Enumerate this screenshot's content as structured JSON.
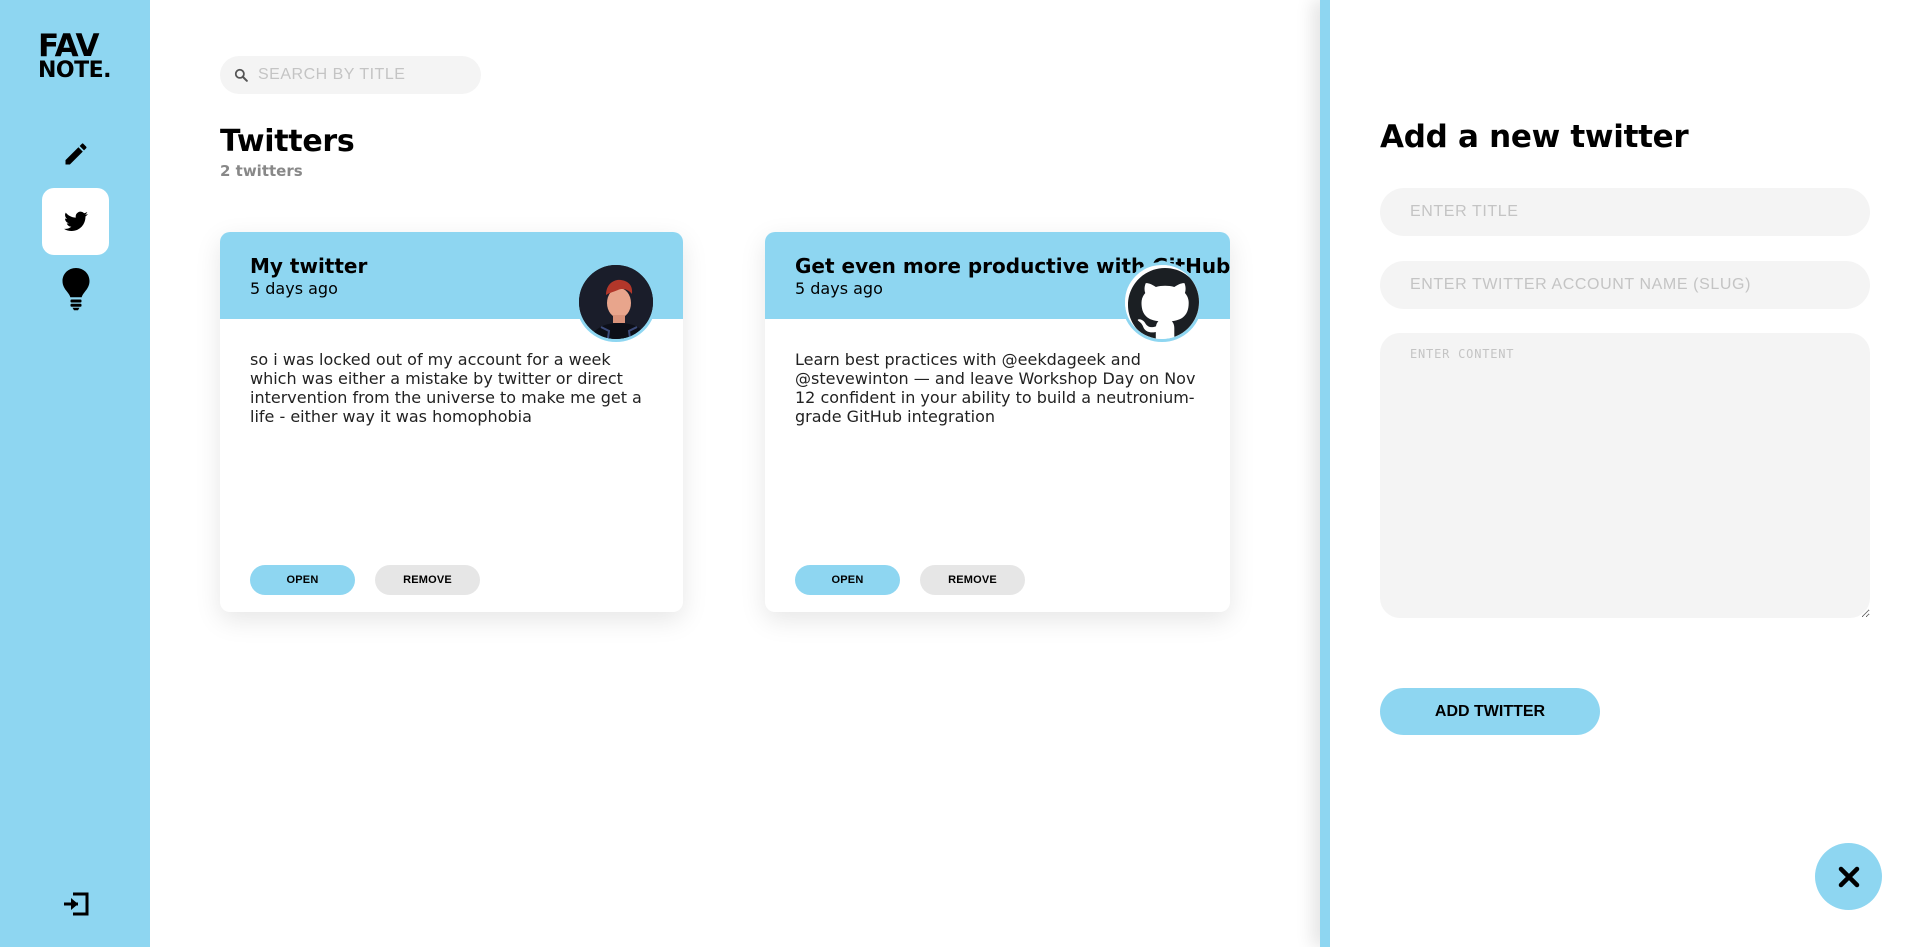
{
  "sidebar": {
    "logo_line1": "FAV",
    "logo_line2": "NOTE.",
    "items": [
      {
        "icon": "pen-icon",
        "active": false
      },
      {
        "icon": "twitter-icon",
        "active": true
      },
      {
        "icon": "bulb-icon",
        "active": false
      }
    ],
    "logout_icon": "logout-icon"
  },
  "main": {
    "search": {
      "placeholder": "SEARCH BY TITLE",
      "value": ""
    },
    "title": "Twitters",
    "count": "2 twitters",
    "cards": [
      {
        "title": "My twitter",
        "date": "5 days ago",
        "content": "so i was locked out of my account for a week which was either a mistake by twitter or direct intervention from the universe to make me get a life - either way it was homophobia",
        "open_label": "OPEN",
        "remove_label": "REMOVE"
      },
      {
        "title": "Get even more productive with GitHub",
        "date": "5 days ago",
        "content": "Learn best practices with @eekdageek and @stevewinton — and leave Workshop Day on Nov 12 confident in your ability to build a neutronium-grade GitHub integration",
        "open_label": "OPEN",
        "remove_label": "REMOVE"
      }
    ]
  },
  "panel": {
    "title": "Add a new twitter",
    "title_placeholder": "ENTER TITLE",
    "slug_placeholder": "ENTER TWITTER ACCOUNT NAME (SLUG)",
    "content_placeholder": "ENTER CONTENT",
    "add_label": "ADD TWITTER",
    "close_icon": "close-icon"
  },
  "colors": {
    "accent": "#8ed6f1",
    "field_bg": "#f4f4f4",
    "remove_bg": "#e6e6e6"
  }
}
